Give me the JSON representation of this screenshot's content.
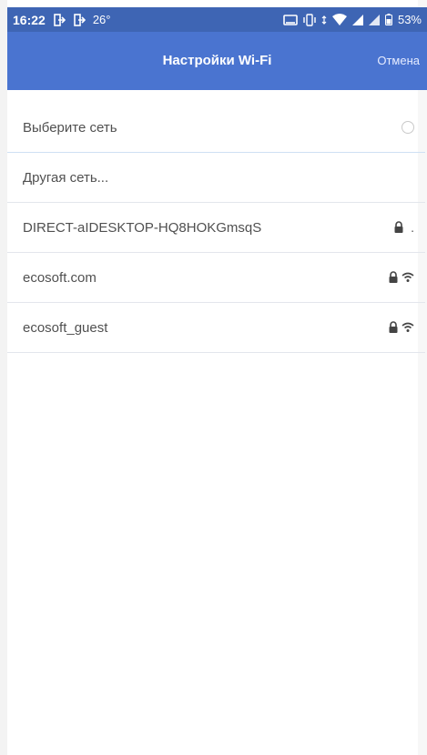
{
  "statusbar": {
    "time": "16:22",
    "temperature": "26°",
    "battery": "53%",
    "left_icons": [
      "sim-swap-icon",
      "sim-swap-icon"
    ],
    "right_icons": [
      "cast-icon",
      "vibrate-icon",
      "data-icon",
      "wifi-signal-icon",
      "cell-signal-icon",
      "cell-signal-icon",
      "battery-icon"
    ]
  },
  "header": {
    "title": "Настройки Wi-Fi",
    "cancel_label": "Отмена",
    "background": "#4a74d0"
  },
  "list": {
    "select_network": "Выберите сеть",
    "other_network": "Другая сеть...",
    "networks": [
      {
        "ssid": "DIRECT-aIDESKTOP-HQ8HOKGmsqS",
        "secured": true,
        "signal": "weak"
      },
      {
        "ssid": "ecosoft.com",
        "secured": true,
        "signal": "wifi"
      },
      {
        "ssid": "ecosoft_guest",
        "secured": true,
        "signal": "wifi"
      }
    ]
  },
  "colors": {
    "statusbar": "#3e65b4",
    "header": "#4a74d0",
    "divider": "#e3e6ec"
  }
}
